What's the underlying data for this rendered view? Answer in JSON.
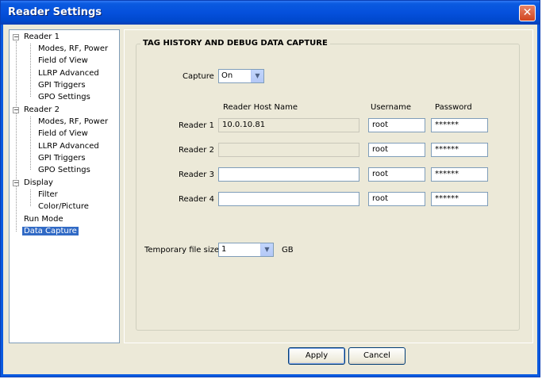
{
  "window": {
    "title": "Reader Settings",
    "close_glyph": "✕"
  },
  "tree": {
    "items": [
      {
        "label": "Reader 1",
        "level": 0,
        "expander": "−"
      },
      {
        "label": "Modes, RF, Power",
        "level": 1
      },
      {
        "label": "Field of View",
        "level": 1
      },
      {
        "label": "LLRP Advanced",
        "level": 1
      },
      {
        "label": "GPI Triggers",
        "level": 1
      },
      {
        "label": "GPO Settings",
        "level": 1
      },
      {
        "label": "Reader 2",
        "level": 0,
        "expander": "−"
      },
      {
        "label": "Modes, RF, Power",
        "level": 1
      },
      {
        "label": "Field of View",
        "level": 1
      },
      {
        "label": "LLRP Advanced",
        "level": 1
      },
      {
        "label": "GPI Triggers",
        "level": 1
      },
      {
        "label": "GPO Settings",
        "level": 1
      },
      {
        "label": "Display",
        "level": 0,
        "expander": "−"
      },
      {
        "label": "Filter",
        "level": 1
      },
      {
        "label": "Color/Picture",
        "level": 1
      },
      {
        "label": "Run Mode",
        "level": 0
      },
      {
        "label": "Data Capture",
        "level": 0,
        "selected": true
      }
    ]
  },
  "panel": {
    "group_title": "TAG HISTORY AND DEBUG DATA CAPTURE",
    "capture": {
      "label": "Capture",
      "value": "On"
    },
    "columns": {
      "host": "Reader Host Name",
      "username": "Username",
      "password": "Password"
    },
    "readers": [
      {
        "label": "Reader 1",
        "host": "10.0.10.81",
        "username": "root",
        "password": "******",
        "host_disabled": true
      },
      {
        "label": "Reader 2",
        "host": "",
        "username": "root",
        "password": "******",
        "host_disabled": true
      },
      {
        "label": "Reader 3",
        "host": "",
        "username": "root",
        "password": "******",
        "host_disabled": false
      },
      {
        "label": "Reader 4",
        "host": "",
        "username": "root",
        "password": "******",
        "host_disabled": false
      }
    ],
    "file_size": {
      "label": "Temporary file size",
      "value": "1",
      "unit": "GB"
    }
  },
  "buttons": {
    "apply": "Apply",
    "cancel": "Cancel"
  },
  "dropdown_arrow": "▼"
}
